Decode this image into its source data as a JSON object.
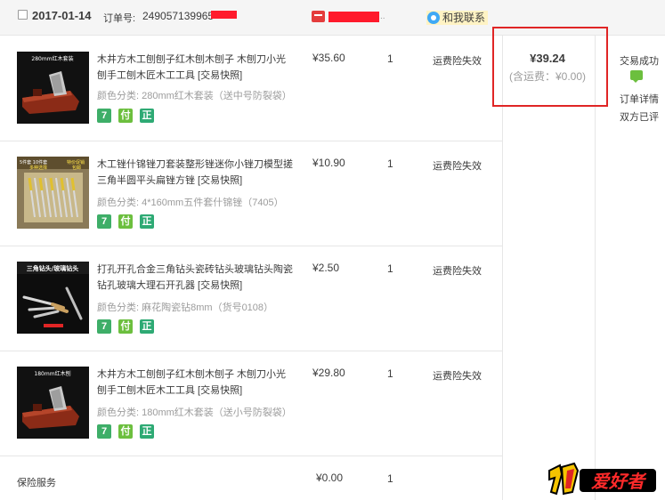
{
  "header": {
    "date": "2017-01-14",
    "order_label": "订单号:",
    "order_no": "249057139965",
    "dots": "..",
    "contact": "和我联系"
  },
  "items": [
    {
      "title": "木井方木工刨刨子红木刨木刨子 木刨刀小光刨手工刨木匠木工工具 [交易快照]",
      "spec_label": "颜色分类:",
      "spec_value": "280mm红木套装（送中号防裂袋）",
      "price": "¥35.60",
      "qty": "1",
      "service": "运费险失效"
    },
    {
      "title": "木工锉什锦锉刀套装整形锉迷你小锉刀模型搓三角半圆平头扁锉方锉 [交易快照]",
      "spec_label": "颜色分类:",
      "spec_value": "4*160mm五件套什锦锉（7405）",
      "price": "¥10.90",
      "qty": "1",
      "service": "运费险失效"
    },
    {
      "title": "打孔开孔合金三角钻头瓷砖钻头玻璃钻头陶瓷钻孔玻璃大理石开孔器 [交易快照]",
      "spec_label": "颜色分类:",
      "spec_value": "麻花陶瓷钻8mm（货号0108）",
      "price": "¥2.50",
      "qty": "1",
      "service": "运费险失效"
    },
    {
      "title": "木井方木工刨刨子红木刨木刨子 木刨刀小光刨手工刨木匠木工工具 [交易快照]",
      "spec_label": "颜色分类:",
      "spec_value": "180mm红木套装（送小号防裂袋）",
      "price": "¥29.80",
      "qty": "1",
      "service": "运费险失效"
    }
  ],
  "insurance": {
    "label": "保险服务",
    "price": "¥0.00",
    "qty": "1"
  },
  "badges": {
    "seven": "7",
    "pay": "付",
    "genuine": "正"
  },
  "summary": {
    "total": "¥39.24",
    "shipping": "(含运费：¥0.00)",
    "status": "交易成功",
    "detail": "订单详情",
    "both_rated": "双方已评"
  },
  "product_images": {
    "plane_caption": "280mm红木套装",
    "file_caption_a": "5件套 10件套",
    "file_caption_b": "多种选择",
    "file_caption_c": "特价促销",
    "file_caption_d": "包邮",
    "drill_caption": "三角钻头/玻璃钻头",
    "plane2_caption": "180mm红木刨"
  },
  "watermark": "爱好者",
  "colors": {
    "accent_red": "#e02525",
    "badge_green": "#3eae68",
    "contact_bg": "#fff3c4"
  }
}
